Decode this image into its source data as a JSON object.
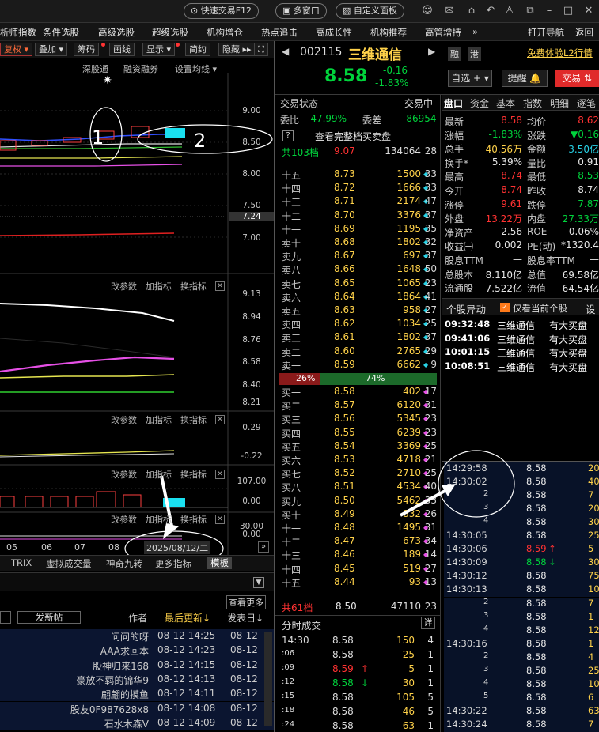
{
  "titlebar": {
    "quick_trade": "快速交易F12",
    "multi_window": "多窗口",
    "custom_panel": "自定义面板",
    "icons": [
      "user-icon",
      "mail-icon",
      "home-icon",
      "undo-icon",
      "shirt-icon",
      "restore-icon",
      "minimize-icon",
      "maximize-icon",
      "close-icon"
    ]
  },
  "menubar": {
    "items": [
      "析师指数",
      "条件选股",
      "高级选股",
      "超级选股",
      "机构增仓",
      "热点追击",
      "高成长性",
      "机构推荐",
      "高管增持"
    ],
    "more": "»",
    "nav": "打开导航",
    "back": "返回"
  },
  "chart_toolbar": {
    "buttons": [
      "复权 ▾",
      "叠加 ▾",
      "筹码",
      "画线",
      "显示 ▾",
      "简约",
      "隐藏 ▸▸"
    ],
    "sub": [
      "深股通",
      "融资融券",
      "设置均线 ▾"
    ]
  },
  "chart": {
    "y_labels_main": [
      "9.00",
      "8.50",
      "8.00",
      "7.50",
      "7.24",
      "7.00"
    ],
    "y_labels_ind1": [
      "9.13",
      "8.94",
      "8.76",
      "8.58",
      "8.40",
      "8.21"
    ],
    "y_labels_ind2": [
      "0.29",
      "-0.22"
    ],
    "y_labels_ind3": [
      "107.00",
      "0.00"
    ],
    "y_labels_ind4": [
      "30.00",
      "0.00"
    ],
    "panel_links": [
      "改参数",
      "加指标",
      "换指标"
    ],
    "x_labels": [
      "05",
      "06",
      "07",
      "08"
    ],
    "date_box": "2025/08/12/二",
    "annotations": [
      "1",
      "2"
    ],
    "bottom_tabs": [
      "TRIX",
      "虚拟成交量",
      "神奇九转",
      "更多指标",
      "模板"
    ]
  },
  "forum": {
    "more": "查看更多",
    "post_button": "发新帖",
    "headers": [
      "作者",
      "最后更新↓",
      "发表日↓"
    ],
    "rows": [
      {
        "author": "问问的呀",
        "updated": "08-12 14:25",
        "posted": "08-12"
      },
      {
        "author": "AAA求回本",
        "updated": "08-12 14:23",
        "posted": "08-12"
      },
      {
        "author": "股神归来168",
        "updated": "08-12 14:15",
        "posted": "08-12"
      },
      {
        "author": "豪放不羁的锦华9",
        "updated": "08-12 14:13",
        "posted": "08-12"
      },
      {
        "author": "翩翩的摸鱼",
        "updated": "08-12 14:11",
        "posted": "08-12"
      },
      {
        "author": "股友0F987628x8",
        "updated": "08-12 14:08",
        "posted": "08-12"
      },
      {
        "author": "石水木森V",
        "updated": "08-12 14:09",
        "posted": "08-12"
      }
    ]
  },
  "stock": {
    "code": "002115",
    "name": "三维通信",
    "price": "8.58",
    "change": "-0.16",
    "change_pct": "-1.83%",
    "tags": [
      "融",
      "港"
    ],
    "l2_link": "免费体验L2行情",
    "watch_button": "自选 + ▾",
    "alert_button": "提醒 🔔",
    "trade_button": "交易 ⇅"
  },
  "orderbook": {
    "status_label": "交易状态",
    "status_value": "交易中",
    "ratio_label": "委比",
    "ratio_value": "-47.99%",
    "diff_label": "委差",
    "diff_value": "-86954",
    "full_view": "查看完整档买卖盘",
    "top_total": {
      "label": "共103档",
      "price": "9.07",
      "vol": "134064",
      "cnt": "28"
    },
    "asks": [
      {
        "label": "十五",
        "price": "8.73",
        "vol": "1500",
        "cnt": "33"
      },
      {
        "label": "十四",
        "price": "8.72",
        "vol": "1666",
        "cnt": "33"
      },
      {
        "label": "十三",
        "price": "8.71",
        "vol": "2174",
        "cnt": "47"
      },
      {
        "label": "十二",
        "price": "8.70",
        "vol": "3376",
        "cnt": "37"
      },
      {
        "label": "十一",
        "price": "8.69",
        "vol": "1195",
        "cnt": "35"
      },
      {
        "label": "卖十",
        "price": "8.68",
        "vol": "1802",
        "cnt": "32"
      },
      {
        "label": "卖九",
        "price": "8.67",
        "vol": "697",
        "cnt": "37"
      },
      {
        "label": "卖八",
        "price": "8.66",
        "vol": "1648",
        "cnt": "50"
      },
      {
        "label": "卖七",
        "price": "8.65",
        "vol": "1065",
        "cnt": "23"
      },
      {
        "label": "卖六",
        "price": "8.64",
        "vol": "1864",
        "cnt": "41"
      },
      {
        "label": "卖五",
        "price": "8.63",
        "vol": "958",
        "cnt": "27"
      },
      {
        "label": "卖四",
        "price": "8.62",
        "vol": "1034",
        "cnt": "25"
      },
      {
        "label": "卖三",
        "price": "8.61",
        "vol": "1802",
        "cnt": "37"
      },
      {
        "label": "卖二",
        "price": "8.60",
        "vol": "2765",
        "cnt": "29"
      },
      {
        "label": "卖一",
        "price": "8.59",
        "vol": "6662",
        "cnt": "9"
      }
    ],
    "bar_left": "26%",
    "bar_right": "74%",
    "bar_left_fraction": 0.26,
    "bids": [
      {
        "label": "买一",
        "price": "8.58",
        "vol": "402",
        "cnt": "17"
      },
      {
        "label": "买二",
        "price": "8.57",
        "vol": "6120",
        "cnt": "31"
      },
      {
        "label": "买三",
        "price": "8.56",
        "vol": "5345",
        "cnt": "23"
      },
      {
        "label": "买四",
        "price": "8.55",
        "vol": "6239",
        "cnt": "23"
      },
      {
        "label": "买五",
        "price": "8.54",
        "vol": "3369",
        "cnt": "25"
      },
      {
        "label": "买六",
        "price": "8.53",
        "vol": "4718",
        "cnt": "21"
      },
      {
        "label": "买七",
        "price": "8.52",
        "vol": "2710",
        "cnt": "25"
      },
      {
        "label": "买八",
        "price": "8.51",
        "vol": "4534",
        "cnt": "40"
      },
      {
        "label": "买九",
        "price": "8.50",
        "vol": "5462",
        "cnt": "33"
      },
      {
        "label": "买十",
        "price": "8.49",
        "vol": "832",
        "cnt": "26"
      },
      {
        "label": "十一",
        "price": "8.48",
        "vol": "1495",
        "cnt": "31"
      },
      {
        "label": "十二",
        "price": "8.47",
        "vol": "673",
        "cnt": "34"
      },
      {
        "label": "十三",
        "price": "8.46",
        "vol": "189",
        "cnt": "14"
      },
      {
        "label": "十四",
        "price": "8.45",
        "vol": "519",
        "cnt": "27"
      },
      {
        "label": "十五",
        "price": "8.44",
        "vol": "93",
        "cnt": "13"
      }
    ],
    "bottom_total": {
      "label": "共61档",
      "price": "8.50",
      "vol": "47110",
      "cnt": "23"
    }
  },
  "trades": {
    "title": "分时成交",
    "detail": "详",
    "rows": [
      {
        "time": "14:30",
        "price": "8.58",
        "vol": "150",
        "cnt": "4",
        "arrow": ""
      },
      {
        "time": ":06",
        "price": "8.58",
        "vol": "25",
        "cnt": "1",
        "arrow": ""
      },
      {
        "time": ":09",
        "price": "8.59",
        "vol": "5",
        "cnt": "1",
        "arrow": "↑"
      },
      {
        "time": ":12",
        "price": "8.58",
        "vol": "30",
        "cnt": "1",
        "arrow": "↓"
      },
      {
        "time": ":15",
        "price": "8.58",
        "vol": "105",
        "cnt": "5",
        "arrow": ""
      },
      {
        "time": ":18",
        "price": "8.58",
        "vol": "46",
        "cnt": "5",
        "arrow": ""
      },
      {
        "time": ":24",
        "price": "8.58",
        "vol": "63",
        "cnt": "1",
        "arrow": ""
      }
    ]
  },
  "tabs": [
    "盘口",
    "资金",
    "基本",
    "指数",
    "明细",
    "逐笔"
  ],
  "stats": [
    {
      "l1": "最新",
      "v1": "8.58",
      "c1": "r",
      "l2": "均价",
      "v2": "8.62",
      "c2": "r"
    },
    {
      "l1": "涨幅",
      "v1": "-1.83%",
      "c1": "g",
      "l2": "涨跌",
      "v2": "▼0.16",
      "c2": "g"
    },
    {
      "l1": "总手",
      "v1": "40.56万",
      "c1": "y",
      "l2": "金额",
      "v2": "3.50亿",
      "c2": "c"
    },
    {
      "l1": "换手*",
      "v1": "5.39%",
      "c1": "w",
      "l2": "量比",
      "v2": "0.91",
      "c2": "w"
    },
    {
      "l1": "最高",
      "v1": "8.74",
      "c1": "r",
      "l2": "最低",
      "v2": "8.53",
      "c2": "g"
    },
    {
      "l1": "今开",
      "v1": "8.74",
      "c1": "r",
      "l2": "昨收",
      "v2": "8.74",
      "c2": "w"
    },
    {
      "l1": "涨停",
      "v1": "9.61",
      "c1": "r",
      "l2": "跌停",
      "v2": "7.87",
      "c2": "g"
    },
    {
      "l1": "外盘",
      "v1": "13.22万",
      "c1": "r",
      "l2": "内盘",
      "v2": "27.33万",
      "c2": "g"
    },
    {
      "l1": "净资产",
      "v1": "2.56",
      "c1": "w",
      "l2": "ROE",
      "v2": "0.06%",
      "c2": "w"
    },
    {
      "l1": "收益㈠",
      "v1": "0.002",
      "c1": "w",
      "l2": "PE(动)",
      "v2": "*1320.4",
      "c2": "w"
    },
    {
      "l1": "股息TTM",
      "v1": "—",
      "c1": "w",
      "l2": "股息率TTM",
      "v2": "—",
      "c2": "w"
    },
    {
      "l1": "总股本",
      "v1": "8.110亿",
      "c1": "w",
      "l2": "总值",
      "v2": "69.58亿",
      "c2": "w"
    },
    {
      "l1": "流通股",
      "v1": "7.522亿",
      "c1": "w",
      "l2": "流值",
      "v2": "64.54亿",
      "c2": "w"
    }
  ],
  "anomaly": {
    "title": "个股异动",
    "checkbox": "仅看当前个股",
    "settings": "设",
    "rows": [
      {
        "time": "09:32:48",
        "name": "三维通信",
        "event": "有大买盘"
      },
      {
        "time": "09:41:06",
        "name": "三维通信",
        "event": "有大买盘"
      },
      {
        "time": "10:01:15",
        "name": "三维通信",
        "event": "有大买盘"
      },
      {
        "time": "10:08:51",
        "name": "三维通信",
        "event": "有大买盘"
      }
    ]
  },
  "ticks": [
    {
      "time": "14:29:58",
      "price": "8.58",
      "vol": "20",
      "c": "w",
      "arrow": ""
    },
    {
      "time": "14:30:02",
      "price": "8.58",
      "vol": "40",
      "c": "w",
      "arrow": ""
    },
    {
      "time": "2",
      "price": "8.58",
      "vol": "7",
      "c": "w",
      "arrow": ""
    },
    {
      "time": "3",
      "price": "8.58",
      "vol": "20",
      "c": "w",
      "arrow": ""
    },
    {
      "time": "4",
      "price": "8.58",
      "vol": "30",
      "c": "w",
      "arrow": ""
    },
    {
      "time": "14:30:05",
      "price": "8.58",
      "vol": "25",
      "c": "w",
      "arrow": ""
    },
    {
      "time": "14:30:06",
      "price": "8.59",
      "vol": "5",
      "c": "r",
      "arrow": "↑"
    },
    {
      "time": "14:30:09",
      "price": "8.58",
      "vol": "30",
      "c": "g",
      "arrow": "↓"
    },
    {
      "time": "14:30:12",
      "price": "8.58",
      "vol": "75",
      "c": "w",
      "arrow": ""
    },
    {
      "time": "14:30:13",
      "price": "8.58",
      "vol": "10",
      "c": "w",
      "arrow": ""
    },
    {
      "time": "2",
      "price": "8.58",
      "vol": "7",
      "c": "w",
      "arrow": ""
    },
    {
      "time": "3",
      "price": "8.58",
      "vol": "1",
      "c": "w",
      "arrow": ""
    },
    {
      "time": "4",
      "price": "8.58",
      "vol": "12",
      "c": "w",
      "arrow": ""
    },
    {
      "time": "14:30:16",
      "price": "8.58",
      "vol": "1",
      "c": "w",
      "arrow": ""
    },
    {
      "time": "2",
      "price": "8.58",
      "vol": "4",
      "c": "w",
      "arrow": ""
    },
    {
      "time": "3",
      "price": "8.58",
      "vol": "25",
      "c": "w",
      "arrow": ""
    },
    {
      "time": "4",
      "price": "8.58",
      "vol": "10",
      "c": "w",
      "arrow": ""
    },
    {
      "time": "5",
      "price": "8.58",
      "vol": "6",
      "c": "w",
      "arrow": ""
    },
    {
      "time": "14:30:22",
      "price": "8.58",
      "vol": "63",
      "c": "w",
      "arrow": ""
    },
    {
      "time": "14:30:24",
      "price": "8.58",
      "vol": "7",
      "c": "w",
      "arrow": ""
    }
  ]
}
